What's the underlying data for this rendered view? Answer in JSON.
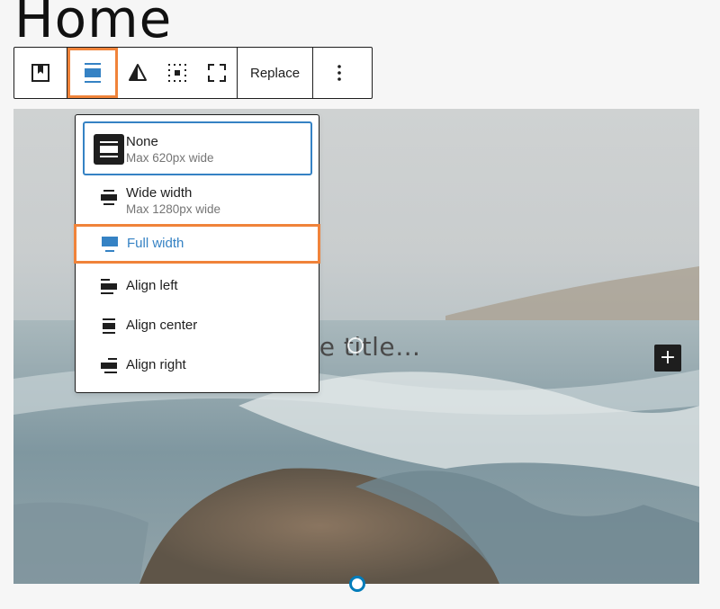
{
  "page": {
    "title": "Home"
  },
  "toolbar": {
    "buttons": [
      {
        "name": "block-type-icon"
      },
      {
        "name": "align-icon"
      },
      {
        "name": "contrast-icon"
      },
      {
        "name": "content-position-icon"
      },
      {
        "name": "fullscreen-icon"
      }
    ],
    "replace_label": "Replace",
    "more_icon": "more-vertical-icon"
  },
  "align_menu": {
    "items": [
      {
        "label": "None",
        "description": "Max 620px wide",
        "icon": "align-none-icon",
        "selected": true
      },
      {
        "label": "Wide width",
        "description": "Max 1280px wide",
        "icon": "align-wide-icon"
      },
      {
        "label": "Full width",
        "icon": "align-full-icon",
        "highlighted": true
      },
      {
        "label": "Align left",
        "icon": "align-left-icon"
      },
      {
        "label": "Align center",
        "icon": "align-center-icon"
      },
      {
        "label": "Align right",
        "icon": "align-right-icon"
      }
    ]
  },
  "cover": {
    "title_placeholder": "ite title…",
    "add_block_icon": "plus-icon"
  },
  "colors": {
    "accent": "#3582c4",
    "highlight": "#f0833a",
    "dark": "#1e1e1e"
  }
}
